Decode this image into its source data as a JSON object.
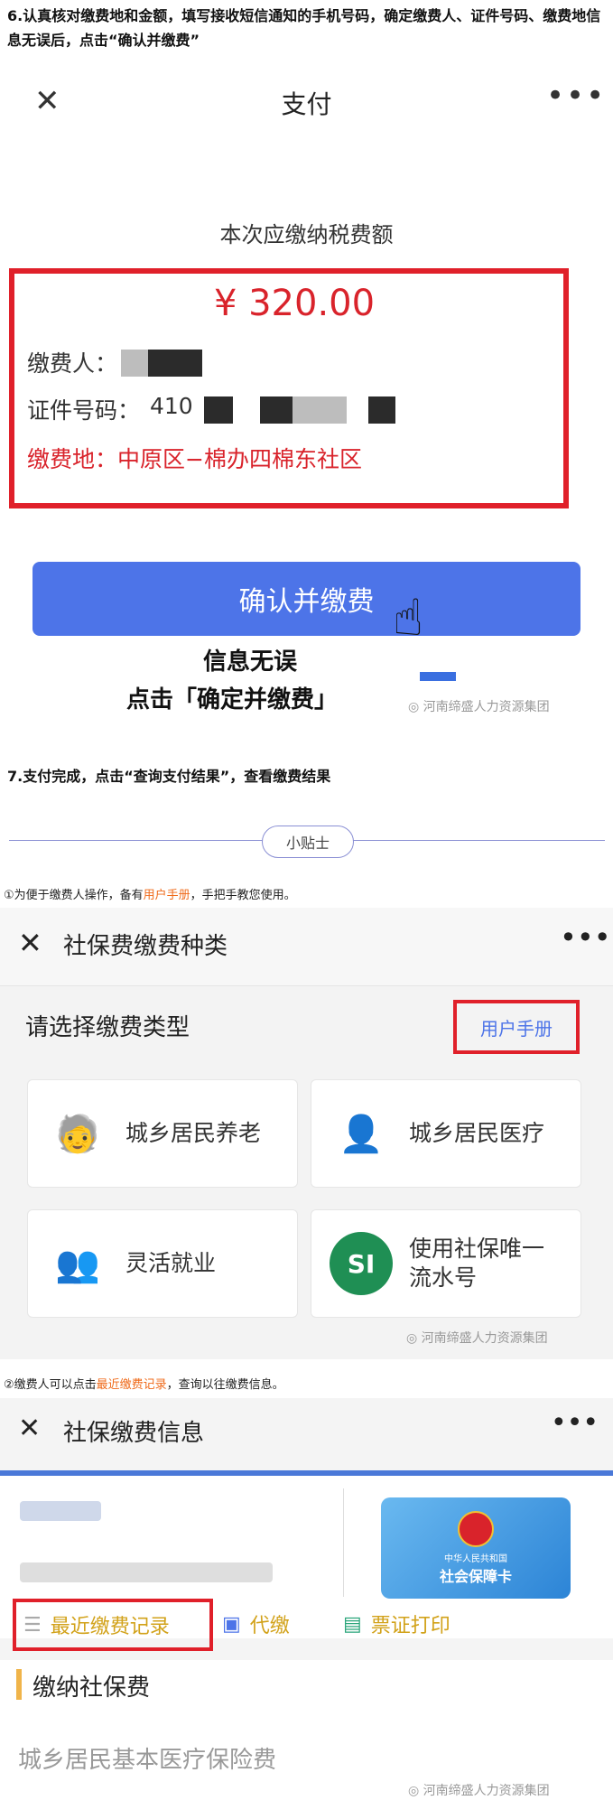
{
  "steps": {
    "step6": "6.认真核对缴费地和金额，填写接收短信通知的手机号码，确定缴费人、证件号码、缴费地信息无误后，点击“确认并缴费”",
    "step7": "7.支付完成，点击“查询支付结果”，查看缴费结果"
  },
  "payment": {
    "close_icon": "close-icon",
    "title": "支付",
    "more_icon": "more-icon",
    "subtitle": "本次应缴纳税费额",
    "amount": "¥ 320.00",
    "payer_label": "缴费人：",
    "id_label": "证件号码：",
    "id_prefix": "410",
    "location": "缴费地：中原区−棉办四棉东社区",
    "confirm_button": "确认并缴费",
    "note_line1": "信息无误",
    "note_line2": "点击「确定并缴费」",
    "watermark": "河南缔盛人力资源集团",
    "highlight_color": "#e0202a",
    "button_color": "#4d74e8"
  },
  "tips": {
    "badge": "小贴士",
    "tip1_prefix": "①为便于缴费人操作，备有",
    "tip1_link": "用户手册",
    "tip1_suffix": "，手把手教您使用。",
    "tip2_prefix": "②缴费人可以点击",
    "tip2_link": "最近缴费记录",
    "tip2_suffix": "，查询以往缴费信息。"
  },
  "categories": {
    "title": "社保费缴费种类",
    "choose_label": "请选择缴费类型",
    "manual_button": "用户手册",
    "items": [
      {
        "label": "城乡居民养老",
        "icon": "elderly-icon"
      },
      {
        "label": "城乡居民医疗",
        "icon": "user-add-icon"
      },
      {
        "label": "灵活就业",
        "icon": "group-icon"
      },
      {
        "label": "使用社保唯一流水号",
        "icon": "si-logo-icon"
      }
    ],
    "watermark": "河南缔盛人力资源集团"
  },
  "info": {
    "title": "社保缴费信息",
    "card_line1": "中华人民共和国",
    "card_line2": "社会保障卡",
    "recent_records": "最近缴费记录",
    "proxy_pay": "代缴",
    "print_receipt": "票证打印",
    "section_title": "缴纳社保费",
    "item1": "城乡居民基本医疗保险费",
    "watermark": "河南缔盛人力资源集团"
  }
}
